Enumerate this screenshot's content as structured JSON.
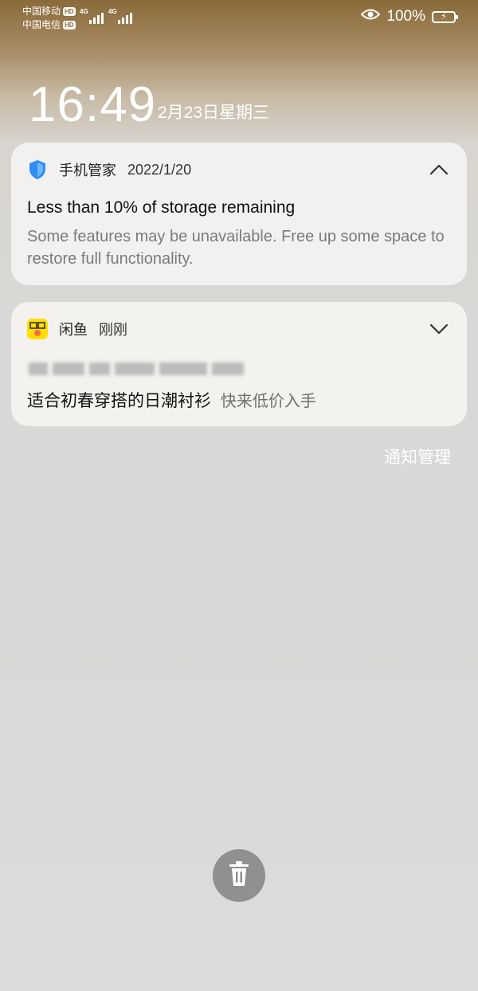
{
  "status_bar": {
    "carrier_1": "中国移动",
    "carrier_2": "中国电信",
    "hd_label": "HD",
    "network_1": "4G",
    "network_2": "4G",
    "battery_percent": "100%",
    "icons": [
      "eye-icon",
      "battery-charging-icon",
      "signal-icon"
    ]
  },
  "lockscreen": {
    "time": "16:49",
    "date": "2月23日星期三"
  },
  "notifications": [
    {
      "app_name": "手机管家",
      "time": "2022/1/20",
      "icon": "shield-icon",
      "expanded": true,
      "title": "Less than 10% of storage remaining",
      "body": "Some features may be unavailable. Free up some space to restore full functionality."
    },
    {
      "app_name": "闲鱼",
      "time": "刚刚",
      "icon": "xianyu-app-icon",
      "expanded": false,
      "title": "适合初春穿搭的日潮衬衫",
      "body": "快来低价入手"
    }
  ],
  "actions": {
    "manage_notifications": "通知管理",
    "clear_all_icon": "trash-icon"
  },
  "colors": {
    "shield": "#2f8cf0",
    "xianyu_yellow": "#ffde00",
    "trash_bg": "#909090"
  }
}
